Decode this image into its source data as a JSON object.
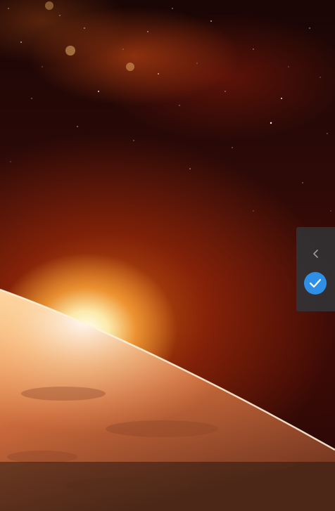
{
  "wallpaper": {
    "description_icon": "space-sunrise-wallpaper"
  },
  "side_panel": {
    "collapse_icon": "chevron-left-icon",
    "confirm_icon": "check-icon",
    "accent_color": "#2f8fe6",
    "panel_color": "#323234"
  },
  "bottom_bar": {
    "color": "#140f0c"
  }
}
